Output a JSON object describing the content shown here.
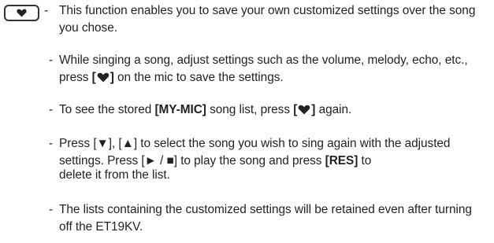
{
  "button": {
    "icon": "heart-icon"
  },
  "items": [
    {
      "dash": "-",
      "text": "This function enables you to save your own customized settings over the song you chose."
    },
    {
      "dash": "-",
      "text_1": "While singing a song, adjust settings such as the volume, melody, echo, etc., press ",
      "bracket_open": "[",
      "bracket_close": "]",
      "text_2": " on the mic to save the settings."
    },
    {
      "dash": "-",
      "text_1": "To see the stored ",
      "bold_1": "[MY-MIC]",
      "text_2": " song list, press ",
      "bracket_open": "[",
      "bracket_close": "]",
      "text_3": " again."
    },
    {
      "dash": "-",
      "text_1": "Press [▼], [▲] to select the song you wish to sing again with the adjusted settings. Press [► / ■] to play the song and press ",
      "bold_1": "[RES]",
      "text_2": " to",
      "line_3": "delete it from the list."
    },
    {
      "dash": "-",
      "text": "The lists containing the customized settings will be retained even after turning off the ET19KV."
    }
  ]
}
